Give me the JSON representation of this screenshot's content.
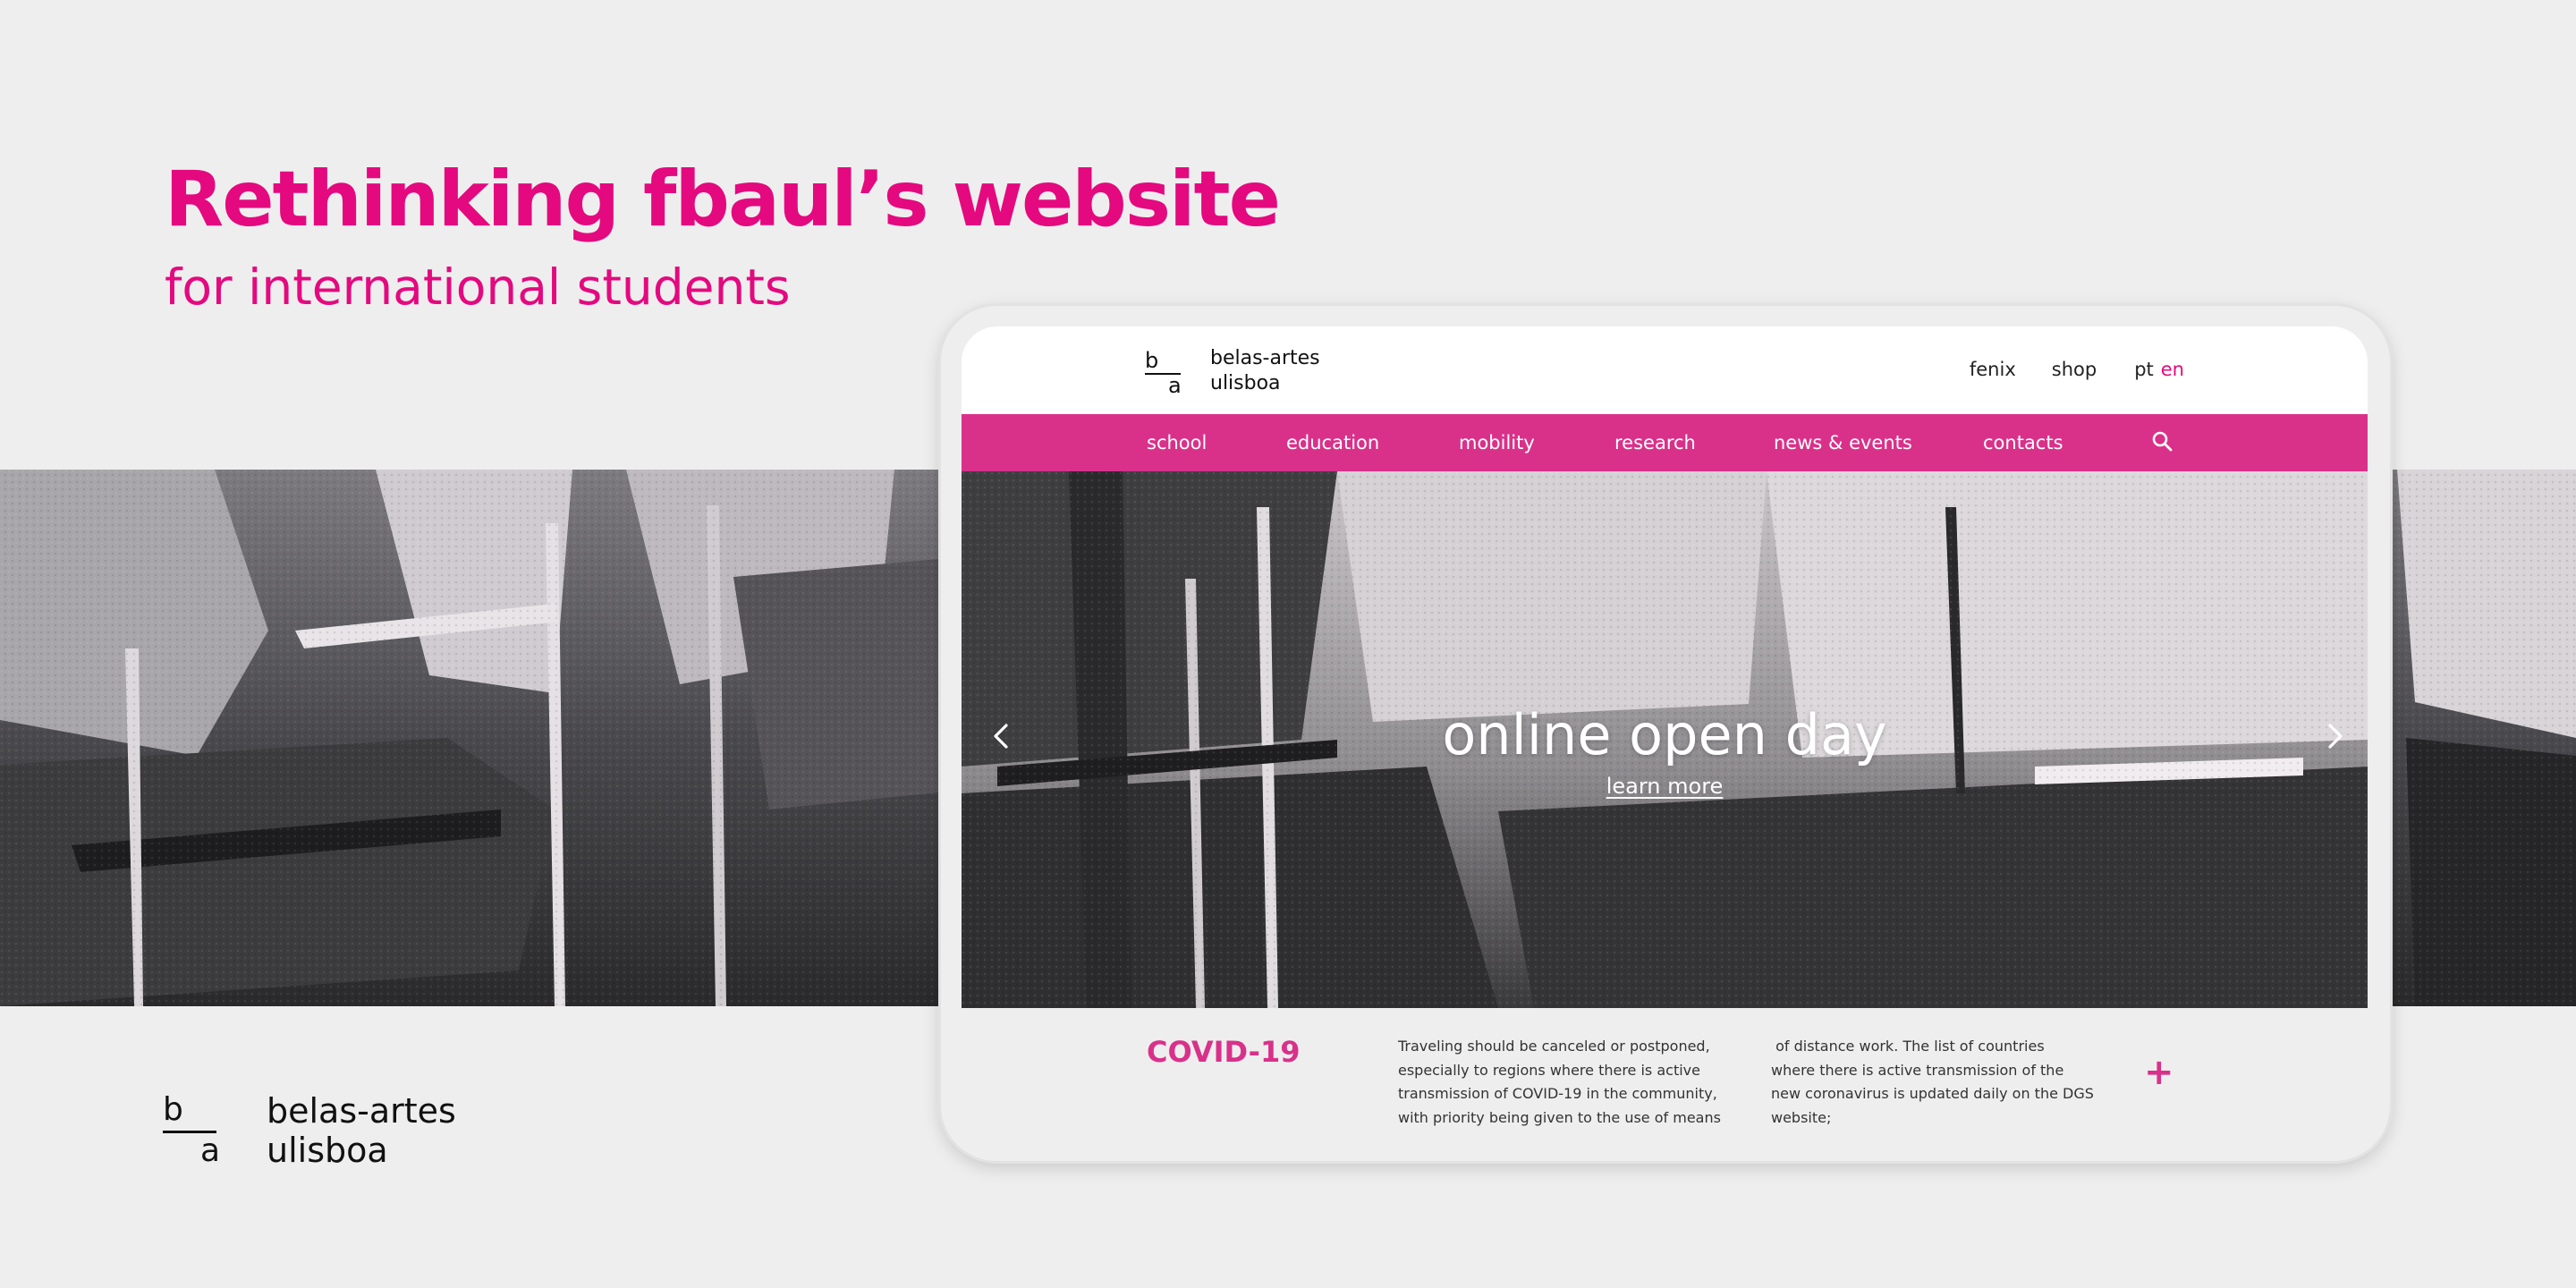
{
  "presentation": {
    "title": "Rethinking fbaul’s website",
    "subtitle": "for international students"
  },
  "brand": {
    "mark_top": "b",
    "mark_bottom": "a",
    "name_line1": "belas-artes",
    "name_line2": "ulisboa"
  },
  "colors": {
    "accent": "#e4097f",
    "nav": "#d9318a",
    "background": "#eeeeee"
  },
  "site": {
    "utility_nav": {
      "fenix": "fenix",
      "shop": "shop",
      "lang_pt": "pt",
      "lang_en": "en"
    },
    "main_nav": [
      "school",
      "education",
      "mobility",
      "research",
      "news & events",
      "contacts"
    ],
    "search_icon": "search-icon",
    "hero": {
      "title": "online open day",
      "link": "learn more",
      "prev_icon": "chevron-left-icon",
      "next_icon": "chevron-right-icon"
    },
    "covid": {
      "title": "COVID-19",
      "col1": [
        "Traveling should be canceled or postponed,",
        "especially to regions where there is active",
        "transmission of COVID-19 in the community,",
        "with priority being given to the use of means"
      ],
      "col2": [
        " of distance work. The list of countries",
        "where there is active transmission of the",
        "new coronavirus is updated daily on the DGS",
        "website;"
      ],
      "expand_label": "+"
    }
  }
}
